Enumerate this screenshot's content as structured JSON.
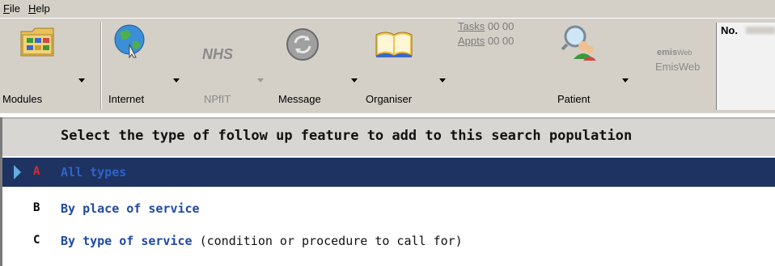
{
  "menu": [
    {
      "underline": "F",
      "rest": "ile"
    },
    {
      "underline": "H",
      "rest": "elp"
    }
  ],
  "toolbar": {
    "modules": "Modules",
    "internet": "Internet",
    "nhs_logo": "NHS",
    "npfit": "NPfIT",
    "message": "Message",
    "organiser": "Organiser",
    "tasks_link": "Tasks",
    "tasks_count": " 00 00",
    "appts_link": "Appts",
    "appts_count": " 00 00",
    "patient": "Patient",
    "emisweb_logo": "emis",
    "emisweb_logo_sub": "Web",
    "emisweb": "EmisWeb"
  },
  "patient_box": {
    "label": "No."
  },
  "panel": {
    "title": "Select the type of follow up feature to add to this search population",
    "options": [
      {
        "key": "A",
        "label": "All types",
        "extra": "",
        "selected": true
      },
      {
        "key": "B",
        "label": "By place of service",
        "extra": "",
        "selected": false
      },
      {
        "key": "C",
        "label": "By type of service",
        "extra": " (condition or procedure to call for)",
        "selected": false
      }
    ]
  },
  "colors": {
    "toolbar_bg": "#d4d0c8",
    "selected_row": "#1e3362",
    "option_link": "#1f4aa0",
    "selected_key": "#e02a2a"
  }
}
